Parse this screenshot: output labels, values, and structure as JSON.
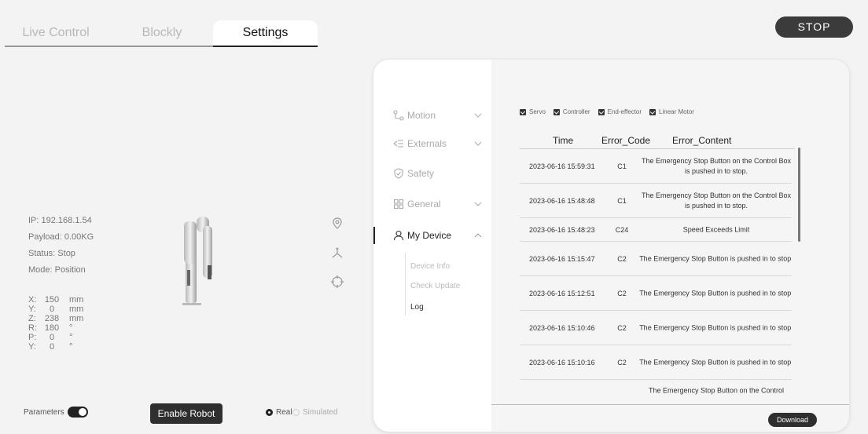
{
  "tabs": [
    {
      "label": "Live Control"
    },
    {
      "label": "Blockly"
    },
    {
      "label": "Settings"
    }
  ],
  "stop_label": "STOP",
  "robot": {
    "ip": "IP: 192.168.1.54",
    "payload": "Payload: 0.00KG",
    "status": "Status: Stop",
    "mode": "Mode: Position",
    "coords": [
      {
        "axis": "X:",
        "value": "150",
        "unit": "mm"
      },
      {
        "axis": "Y:",
        "value": "0",
        "unit": "mm"
      },
      {
        "axis": "Z:",
        "value": "238",
        "unit": "mm"
      },
      {
        "axis": "R:",
        "value": "180",
        "unit": "°"
      },
      {
        "axis": "P:",
        "value": "0",
        "unit": "°"
      },
      {
        "axis": "Y:",
        "value": "0",
        "unit": "°"
      }
    ]
  },
  "bottom": {
    "parameters_label": "Parameters",
    "parameters_on": true,
    "enable_label": "Enable Robot",
    "real_label": "Real",
    "simulated_label": "Simulated",
    "selected_mode": "Real"
  },
  "settings_nav": {
    "items": [
      {
        "label": "Motion",
        "icon": "motion-icon",
        "has_chevron": true
      },
      {
        "label": "Externals",
        "icon": "externals-icon",
        "has_chevron": true
      },
      {
        "label": "Safety",
        "icon": "shield-icon",
        "has_chevron": false
      },
      {
        "label": "General",
        "icon": "grid-icon",
        "has_chevron": true
      },
      {
        "label": "My Device",
        "icon": "user-icon",
        "has_chevron": true,
        "active": true
      }
    ],
    "subitems": [
      {
        "label": "Device Info"
      },
      {
        "label": "Check Update"
      },
      {
        "label": "Log",
        "active": true
      }
    ]
  },
  "log": {
    "filters": [
      {
        "label": "Servo",
        "checked": true
      },
      {
        "label": "Controller",
        "checked": true
      },
      {
        "label": "End-effector",
        "checked": true
      },
      {
        "label": "Linear Motor",
        "checked": true
      }
    ],
    "headers": {
      "time": "Time",
      "code": "Error_Code",
      "content": "Error_Content"
    },
    "rows": [
      {
        "time": "2023-06-16 15:59:31",
        "code": "C1",
        "content": "The Emergency Stop Button on the Control Box is pushed in to stop."
      },
      {
        "time": "2023-06-16 15:48:48",
        "code": "C1",
        "content": "The Emergency Stop Button on the Control Box is pushed in to stop."
      },
      {
        "time": "2023-06-16 15:48:23",
        "code": "C24",
        "content": "Speed Exceeds Limit"
      },
      {
        "time": "2023-06-16 15:15:47",
        "code": "C2",
        "content": "The Emergency Stop Button is pushed in to stop."
      },
      {
        "time": "2023-06-16 15:12:51",
        "code": "C2",
        "content": "The Emergency Stop Button is pushed in to stop."
      },
      {
        "time": "2023-06-16 15:10:46",
        "code": "C2",
        "content": "The Emergency Stop Button is pushed in to stop."
      },
      {
        "time": "2023-06-16 15:10:16",
        "code": "C2",
        "content": "The Emergency Stop Button is pushed in to stop."
      },
      {
        "time": "",
        "code": "",
        "content": "The Emergency Stop Button on the Control"
      }
    ],
    "download_label": "Download"
  }
}
